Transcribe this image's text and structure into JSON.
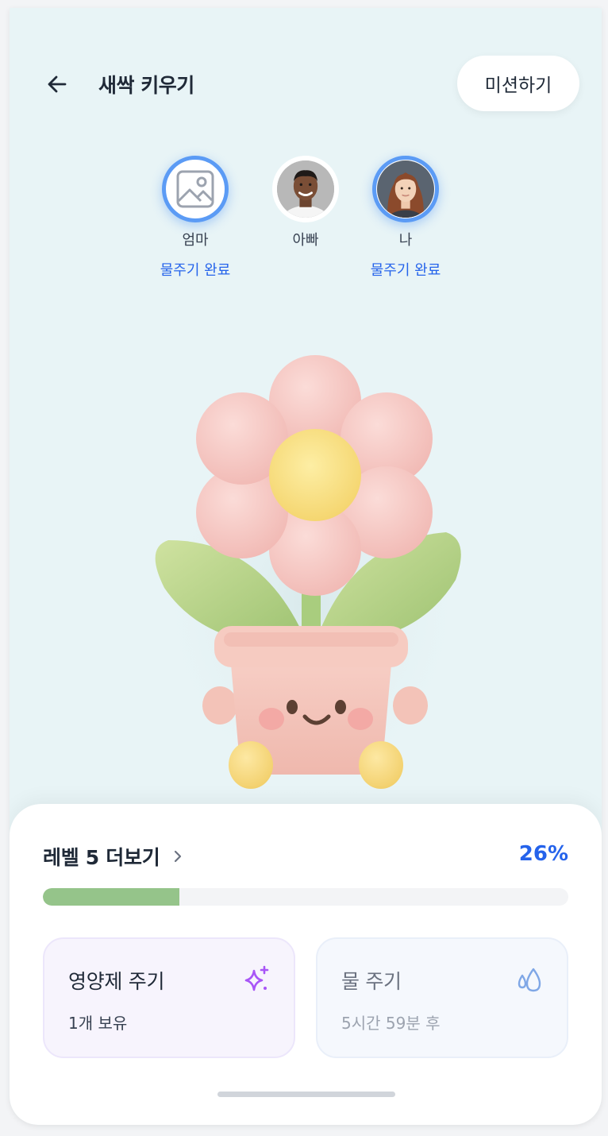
{
  "header": {
    "title": "새싹 키우기",
    "mission_label": "미션하기"
  },
  "members": [
    {
      "name": "엄마",
      "status": "물주기 완료",
      "active": true,
      "avatar": "image-placeholder-icon"
    },
    {
      "name": "아빠",
      "status": "",
      "active": false,
      "avatar": "avatar-photo-dad"
    },
    {
      "name": "나",
      "status": "물주기 완료",
      "active": true,
      "avatar": "avatar-photo-me"
    }
  ],
  "plant": {
    "icon": "flower-pot-illustration"
  },
  "level": {
    "label": "레벨 5 더보기",
    "percent_text": "26%",
    "progress": 0.26
  },
  "actions": {
    "nutrient": {
      "title": "영양제 주기",
      "sub": "1개 보유",
      "icon": "sparkle-icon"
    },
    "water": {
      "title": "물 주기",
      "sub": "5시간 59분 후",
      "icon": "water-drop-icon"
    }
  },
  "colors": {
    "background": "#e8f4f6",
    "accent": "#2563eb",
    "progress": "#95c48a",
    "active_ring": "#5b9bf5",
    "nutrient_icon": "#a855f7",
    "water_icon": "#7fa7e6"
  }
}
